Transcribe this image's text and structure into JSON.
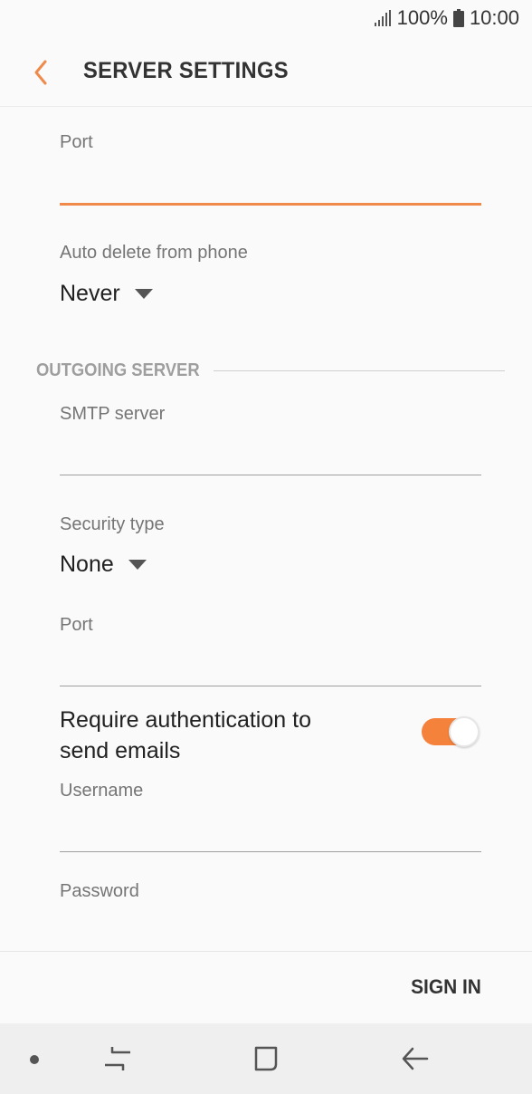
{
  "status_bar": {
    "battery_percent": "100%",
    "time": "10:00",
    "signal_icon": "signal-icon",
    "battery_icon": "battery-icon"
  },
  "header": {
    "back_icon": "chevron-left-icon",
    "title": "SERVER SETTINGS"
  },
  "incoming": {
    "port_label": "Port",
    "port_value": "",
    "auto_delete_label": "Auto delete from phone",
    "auto_delete_value": "Never"
  },
  "outgoing": {
    "section_title": "OUTGOING SERVER",
    "smtp_label": "SMTP server",
    "smtp_value": "",
    "security_label": "Security type",
    "security_value": "None",
    "port_label": "Port",
    "port_value": "",
    "require_auth_label": "Require authentication to send emails",
    "require_auth_enabled": true,
    "username_label": "Username",
    "username_value": "",
    "password_label": "Password"
  },
  "footer": {
    "sign_in_label": "SIGN IN"
  },
  "nav_bar": {
    "items": [
      "dot-icon",
      "recent-apps-icon",
      "home-icon",
      "back-arrow-icon"
    ]
  },
  "colors": {
    "accent": "#f5823b",
    "background": "#fafafa",
    "nav_background": "#efefef"
  }
}
